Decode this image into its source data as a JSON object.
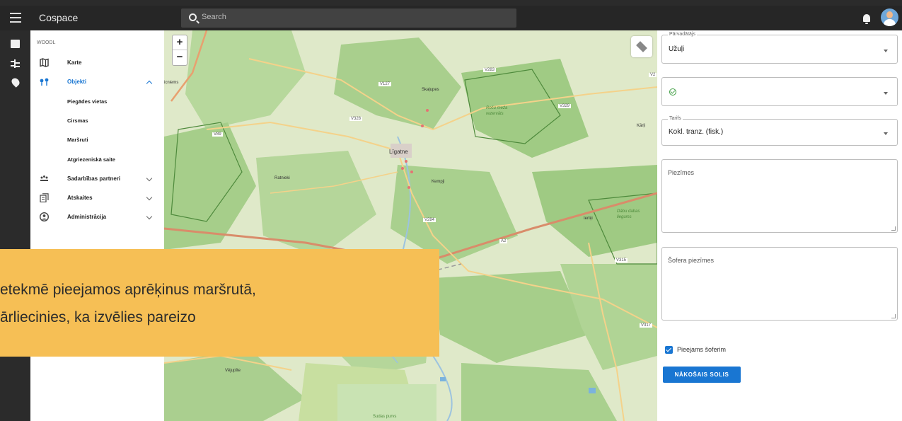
{
  "app": {
    "title": "Cospace"
  },
  "search": {
    "placeholder": "Search"
  },
  "sidebar": {
    "org": "WOODL",
    "items": [
      {
        "label": "Karte",
        "icon": "map-icon"
      },
      {
        "label": "Objekti",
        "icon": "objects-icon",
        "active": true,
        "expanded": true
      },
      {
        "label": "Sadarbības partneri",
        "icon": "partners-icon"
      },
      {
        "label": "Atskaites",
        "icon": "reports-icon"
      },
      {
        "label": "Administrācija",
        "icon": "admin-icon"
      }
    ],
    "subitems": [
      "Piegādes vietas",
      "Cirsmas",
      "Maršruti",
      "Atgriezeniskā saite"
    ]
  },
  "map": {
    "zoom_in": "+",
    "zoom_out": "−",
    "labels": [
      "V283",
      "V127",
      "Skaļupes",
      "Roču meža rezervāts",
      "V329",
      "V328",
      "V89",
      "Līgatne",
      "Ratnieki",
      "Kempji",
      "V284",
      "A2",
      "V315",
      "V317",
      "Vējupīte",
      "Sudas purvs",
      "Kārļi",
      "icniems",
      "Ieriķi",
      "Dābu dabas liegums",
      "V2"
    ]
  },
  "form": {
    "carrier": {
      "label": "Pārvadātājs",
      "value": "Užuļi"
    },
    "tariff": {
      "label": "Tarifs",
      "value": "Kokl. tranz. (fisk.)"
    },
    "notes": {
      "placeholder": "Piezīmes"
    },
    "driver_notes": {
      "placeholder": "Šofera piezīmes"
    },
    "available_checkbox": "Pieejams šoferim",
    "next_button": "NĀKOŠAIS SOLIS"
  },
  "callout": {
    "line1": "etekmē pieejamos aprēķinus maršrutā,",
    "line2": "ārliecinies, ka izvēlies pareizo"
  },
  "colors": {
    "accent": "#1976d2",
    "callout": "#f6bf55",
    "map_forest": "#a8d08d",
    "map_road": "#f6cf80"
  }
}
